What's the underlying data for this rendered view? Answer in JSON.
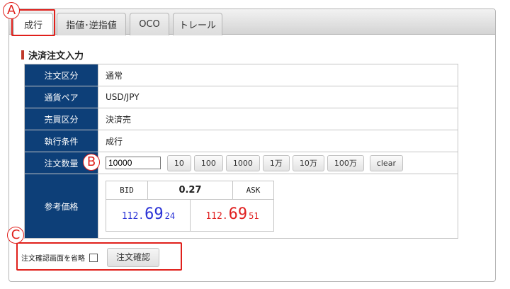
{
  "tabs": [
    {
      "label": "成行",
      "active": true
    },
    {
      "label": "指値･逆指値",
      "active": false
    },
    {
      "label": "OCO",
      "active": false
    },
    {
      "label": "トレール",
      "active": false
    }
  ],
  "section_title": "決済注文入力",
  "form": {
    "rows": [
      {
        "label": "注文区分",
        "value": "通常"
      },
      {
        "label": "通貨ペア",
        "value": "USD/JPY"
      },
      {
        "label": "売買区分",
        "value": "決済売"
      },
      {
        "label": "執行条件",
        "value": "成行"
      }
    ],
    "quantity": {
      "label": "注文数量",
      "value": "10000",
      "buttons": [
        "10",
        "100",
        "1000",
        "1万",
        "10万",
        "100万"
      ],
      "clear_label": "clear"
    },
    "price": {
      "label": "参考価格",
      "bid_label": "BID",
      "spread": "0.27",
      "ask_label": "ASK",
      "bid": {
        "head": "112.",
        "big": "69",
        "tail": "24"
      },
      "ask": {
        "head": "112.",
        "big": "69",
        "tail": "51"
      }
    }
  },
  "footer": {
    "skip_confirm_label": "注文確認画面を省略",
    "submit_label": "注文確認"
  },
  "annotations": {
    "a": "A",
    "b": "B",
    "c": "C"
  },
  "colors": {
    "label_bg": "#0d3f78",
    "bid": "#2a32d6",
    "ask": "#e02020",
    "highlight": "#e0201b"
  }
}
